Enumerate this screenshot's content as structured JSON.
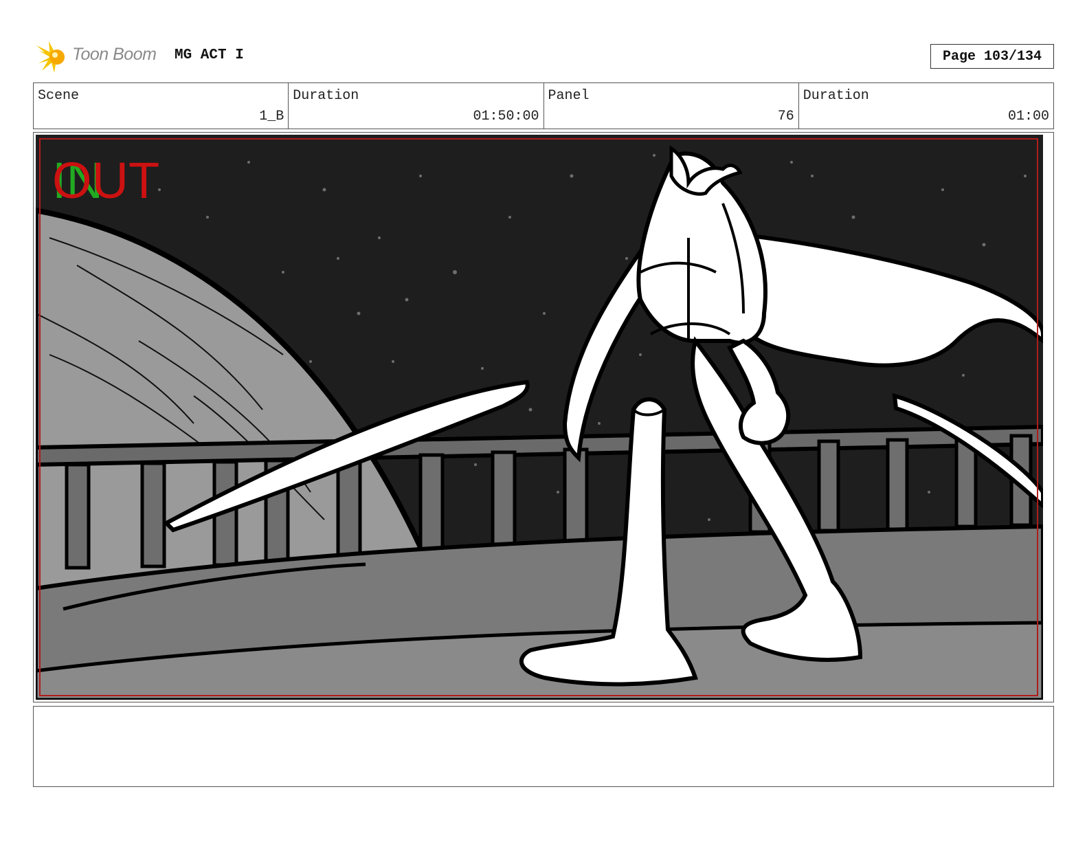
{
  "header": {
    "brand": "Toon Boom",
    "project": "MG ACT I",
    "page": "Page 103/134",
    "logo_icon": "toon-boom-starburst-icon",
    "logo_color": "#f5c400"
  },
  "info": {
    "scene_label": "Scene",
    "scene_value": "1_B",
    "duration_label": "Duration",
    "duration_value": "01:50:00",
    "panel_label": "Panel",
    "panel_value": "76",
    "panel_duration_label": "Duration",
    "panel_duration_value": "01:00"
  },
  "panel": {
    "overlay_in": "IN",
    "overlay_out": "OUT",
    "in_color": "#22aa22",
    "out_color": "#cc1111",
    "safe_frame_color": "#b01c1c"
  },
  "notes": {
    "text": ""
  }
}
